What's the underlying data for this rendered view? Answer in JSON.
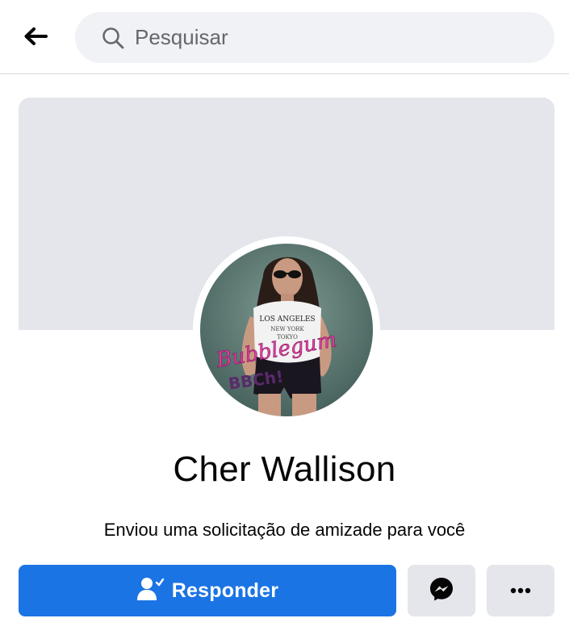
{
  "search": {
    "placeholder": "Pesquisar"
  },
  "icons": {
    "back": "arrow-left-icon",
    "search": "search-icon",
    "respond": "person-check-icon",
    "messenger": "messenger-icon",
    "more": "more-horizontal-icon"
  },
  "profile": {
    "name": "Cher Wallison",
    "request_text": "Enviou uma solicitação de amizade para você",
    "avatar_caption": "Bubblegum BBCh!"
  },
  "actions": {
    "respond_label": "Responder"
  },
  "colors": {
    "primary_button": "#1b74e4",
    "secondary_button": "#e4e6eb",
    "cover": "#e4e6eb",
    "search_background": "#f0f2f5",
    "text": "#050505",
    "muted_text": "#65676b"
  }
}
